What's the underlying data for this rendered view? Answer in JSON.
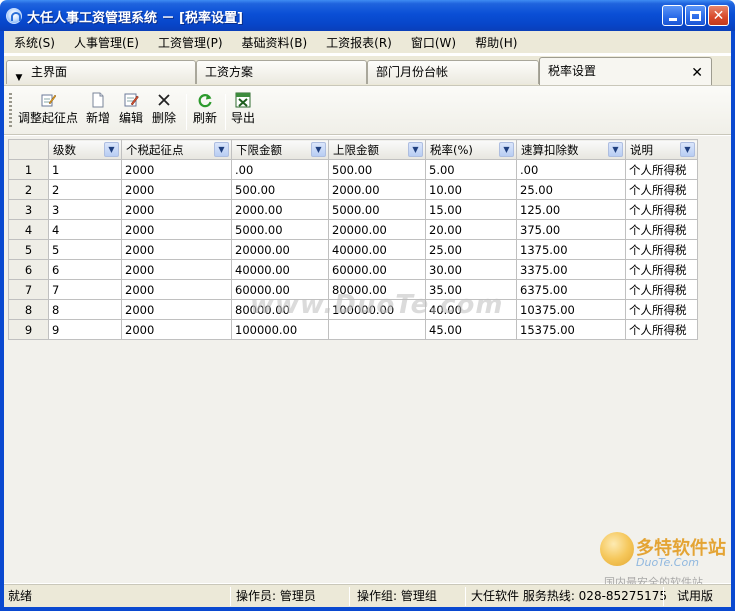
{
  "window": {
    "title": "大任人事工资管理系统 － [税率设置]",
    "controls": {
      "minimize": "minimize",
      "maximize": "maximize",
      "close": "close"
    }
  },
  "menu": [
    {
      "label": "系统(S)"
    },
    {
      "label": "人事管理(E)"
    },
    {
      "label": "工资管理(P)"
    },
    {
      "label": "基础资料(B)"
    },
    {
      "label": "工资报表(R)"
    },
    {
      "label": "窗口(W)"
    },
    {
      "label": "帮助(H)"
    }
  ],
  "tabs": [
    {
      "label": "主界面"
    },
    {
      "label": "工资方案"
    },
    {
      "label": "部门月份台帐"
    },
    {
      "label": "税率设置",
      "active": true
    }
  ],
  "toolbar": {
    "adjust_threshold": "调整起征点",
    "add": "新增",
    "edit": "编辑",
    "delete": "删除",
    "refresh": "刷新",
    "export": "导出"
  },
  "grid": {
    "columns": [
      "级数",
      "个税起征点",
      "下限金额",
      "上限金额",
      "税率(%)",
      "速算扣除数",
      "说明"
    ],
    "rows": [
      {
        "num": "1",
        "cells": [
          "1",
          "2000",
          ".00",
          "500.00",
          "5.00",
          ".00",
          "个人所得税"
        ]
      },
      {
        "num": "2",
        "cells": [
          "2",
          "2000",
          "500.00",
          "2000.00",
          "10.00",
          "25.00",
          "个人所得税"
        ]
      },
      {
        "num": "3",
        "cells": [
          "3",
          "2000",
          "2000.00",
          "5000.00",
          "15.00",
          "125.00",
          "个人所得税"
        ]
      },
      {
        "num": "4",
        "cells": [
          "4",
          "2000",
          "5000.00",
          "20000.00",
          "20.00",
          "375.00",
          "个人所得税"
        ]
      },
      {
        "num": "5",
        "cells": [
          "5",
          "2000",
          "20000.00",
          "40000.00",
          "25.00",
          "1375.00",
          "个人所得税"
        ]
      },
      {
        "num": "6",
        "cells": [
          "6",
          "2000",
          "40000.00",
          "60000.00",
          "30.00",
          "3375.00",
          "个人所得税"
        ]
      },
      {
        "num": "7",
        "cells": [
          "7",
          "2000",
          "60000.00",
          "80000.00",
          "35.00",
          "6375.00",
          "个人所得税"
        ]
      },
      {
        "num": "8",
        "cells": [
          "8",
          "2000",
          "80000.00",
          "100000.00",
          "40.00",
          "10375.00",
          "个人所得税"
        ]
      },
      {
        "num": "9",
        "cells": [
          "9",
          "2000",
          "100000.00",
          "",
          "45.00",
          "15375.00",
          "个人所得税"
        ]
      }
    ]
  },
  "watermark": {
    "center": "www.DuoTe.com",
    "logo_main": "多特软件站",
    "logo_sub": "DuoTe.Com",
    "logo_tag": "国内最安全的软件站"
  },
  "statusbar": {
    "status": "就绪",
    "operator": "操作员: 管理员",
    "group": "操作组: 管理组",
    "company": "大任软件 服务热线: 028-85275175",
    "edition": "试用版"
  },
  "colors": {
    "titlebar": "#0a4fd6",
    "chrome": "#ece9d8",
    "close_button": "#d8492a"
  }
}
